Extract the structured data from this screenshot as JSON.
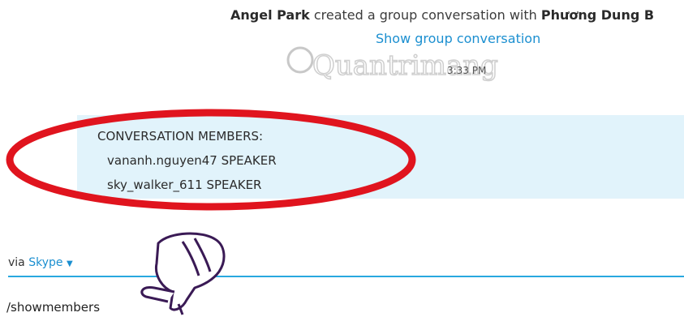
{
  "notice": {
    "actor": "Angel Park",
    "text": " created a group conversation with ",
    "target": "Phương Dung B"
  },
  "show_group_link": "Show group conversation",
  "timestamp": "3:33 PM",
  "watermark": "Quantrimang",
  "members": {
    "header": "CONVERSATION MEMBERS:",
    "list": [
      {
        "name": "vananh.nguyen47",
        "role": "SPEAKER"
      },
      {
        "name": "sky_walker_611",
        "role": "SPEAKER"
      }
    ]
  },
  "compose": {
    "via_label": "via",
    "service": "Skype",
    "service_chevron": "chevron-down-icon",
    "input_value": "/showmembers"
  },
  "colors": {
    "accent": "#1b8fd0",
    "bubble": "#e1f3fb",
    "highlight_ellipse": "#e0141e",
    "compose_line": "#29a8df"
  }
}
